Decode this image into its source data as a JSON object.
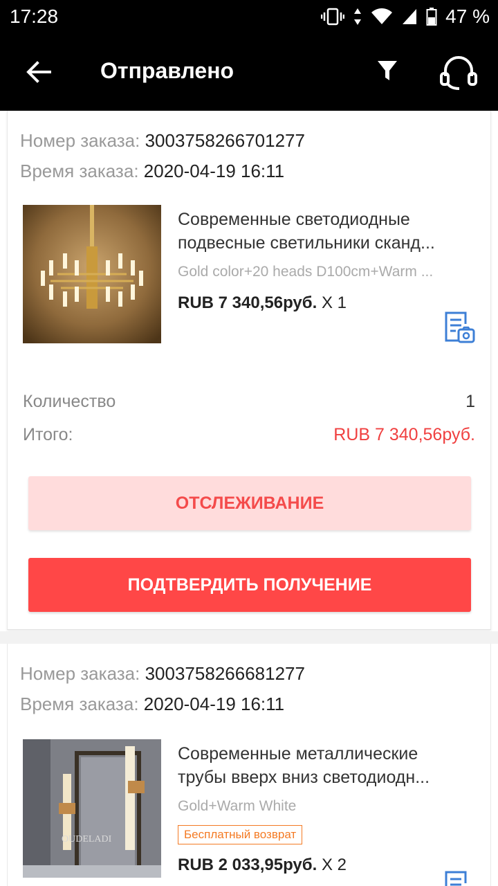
{
  "status_bar": {
    "time": "17:28",
    "battery": "47 %"
  },
  "app_bar": {
    "title": "Отправлено",
    "icons": [
      "back-arrow-icon",
      "filter-icon",
      "headset-icon"
    ]
  },
  "orders": [
    {
      "order_number_label": "Номер заказа:",
      "order_number": "3003758266701277",
      "order_time_label": "Время заказа:",
      "order_time": "2020-04-19 16:11",
      "product_title_line1": "Современные светодиодные",
      "product_title_line2": "подвесные светильники сканд...",
      "variant": "Gold color+20 heads D100cm+Warm ...",
      "price": "RUB 7 340,56руб.",
      "quantity_mult": "X 1",
      "quantity_label": "Количество",
      "quantity_value": "1",
      "total_label": "Итого:",
      "total_value": "RUB 7 340,56руб.",
      "track_button": "ОТСЛЕЖИВАНИЕ",
      "confirm_button": "ПОДТВЕРДИТЬ ПОЛУЧЕНИЕ"
    },
    {
      "order_number_label": "Номер заказа:",
      "order_number": "3003758266681277",
      "order_time_label": "Время заказа:",
      "order_time": "2020-04-19 16:11",
      "product_title_line1": "Современные металлические",
      "product_title_line2": "трубы вверх вниз светодиодн...",
      "variant": "Gold+Warm White",
      "badge": "Бесплатный возврат",
      "price": "RUB 2 033,95руб.",
      "quantity_mult": "X 2",
      "watermark": "OUDELADI"
    }
  ],
  "colors": {
    "accent_red": "#ff4747",
    "price_red": "#f04040",
    "track_bg": "#ffdcdc",
    "badge_orange": "#f47a23",
    "review_icon_blue": "#3d7fd6"
  }
}
